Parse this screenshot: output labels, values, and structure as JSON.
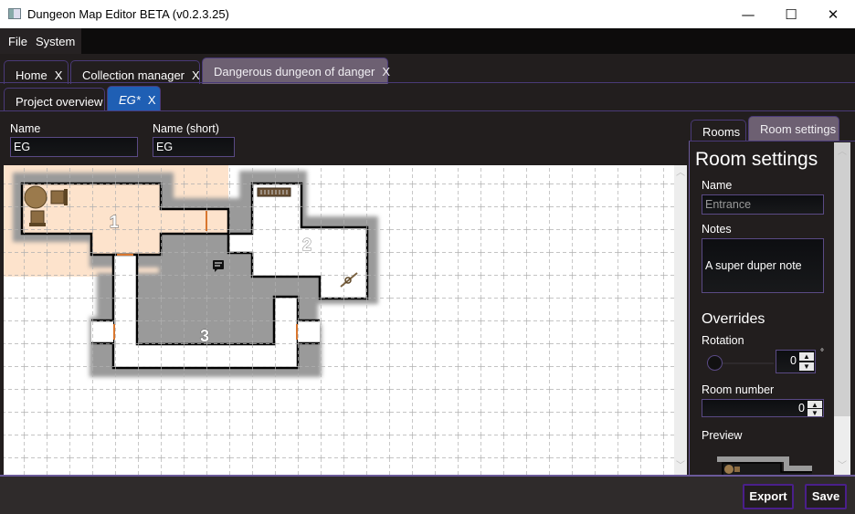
{
  "window": {
    "title": "Dungeon Map Editor BETA (v0.2.3.25)",
    "controls": {
      "minimize": "—",
      "maximize": "☐",
      "close": "✕"
    }
  },
  "menu": {
    "items": [
      "File",
      "System"
    ]
  },
  "main_tabs": [
    {
      "label": "Home",
      "close": "X",
      "active": false
    },
    {
      "label": "Collection manager",
      "close": "X",
      "active": false
    },
    {
      "label": "Dangerous dungeon of danger",
      "close": "X",
      "active": true
    }
  ],
  "project_tabs": [
    {
      "label": "Project overview",
      "active": false
    },
    {
      "label": "EG*",
      "close": "X",
      "active": true
    }
  ],
  "level": {
    "name_label": "Name",
    "name_value": "EG",
    "short_label": "Name (short)",
    "short_value": "EG"
  },
  "map": {
    "rooms": [
      {
        "number": "1",
        "name": "Entrance",
        "selected": true
      },
      {
        "number": "2"
      },
      {
        "number": "3"
      }
    ],
    "icons": [
      "round-table-icon",
      "chair-icon",
      "chair-icon",
      "bookshelf-icon",
      "note-icon",
      "rope-icon"
    ]
  },
  "side_tabs": [
    {
      "label": "Rooms",
      "active": false
    },
    {
      "label": "Room settings",
      "active": true
    }
  ],
  "room_settings": {
    "heading": "Room settings",
    "name_label": "Name",
    "name_placeholder": "Entrance",
    "notes_label": "Notes",
    "notes_value": "A super duper note",
    "overrides_heading": "Overrides",
    "rotation_label": "Rotation",
    "rotation_value": "0",
    "rotation_unit": "°",
    "room_number_label": "Room number",
    "room_number_value": "0",
    "preview_label": "Preview"
  },
  "footer": {
    "export_label": "Export",
    "save_label": "Save"
  },
  "colors": {
    "accent": "#4a1f8a",
    "active_tab_blue": "#1f5fb4",
    "active_tab_grey": "#6d6072",
    "selected_room": "#fde3cc"
  }
}
